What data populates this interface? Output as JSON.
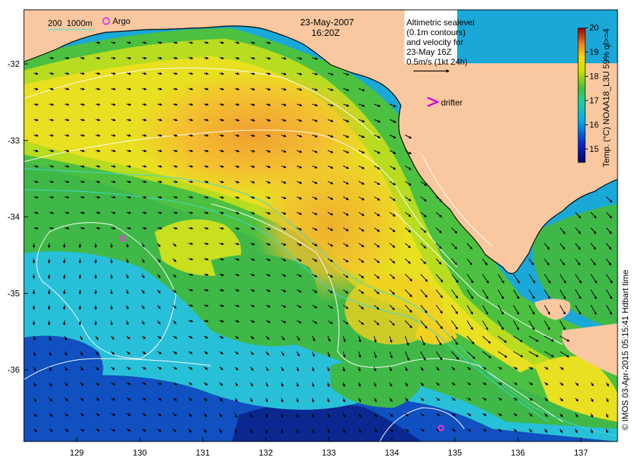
{
  "header": {
    "date": "23-May-2007",
    "time": "16:20Z"
  },
  "legend_left": {
    "isobath_labels": "200  1000m",
    "argo_label": "Argo"
  },
  "annotation": {
    "lines": [
      "Altimetric sealevel",
      "(0.1m contours)",
      "and velocity for",
      "23-May 16Z",
      "0.5m/s (1kt 24h)"
    ],
    "drifter_label": "drifter"
  },
  "colorbar": {
    "label": "Temp. (°C) NOAA18_L3U 59% ql>=4",
    "ticks": [
      "15",
      "16",
      "17",
      "18",
      "19",
      "20"
    ]
  },
  "axes": {
    "x_ticks": [
      "129",
      "130",
      "131",
      "132",
      "133",
      "134",
      "135",
      "136",
      "137"
    ],
    "y_ticks": [
      "-32",
      "-33",
      "-34",
      "-35",
      "-36"
    ]
  },
  "credit": "© IMOS 03-Apr-2015 05:15:41 Hdbart time",
  "colors": {
    "land": "#f9c8a0",
    "argo": "#e83cd9",
    "drifter": "#d400d4",
    "contour": "#ffffff",
    "isobath": "#40d8d8"
  },
  "argo_floats": [
    {
      "lon": 129.73,
      "lat": -34.28
    },
    {
      "lon": 134.78,
      "lat": -36.76
    }
  ]
}
